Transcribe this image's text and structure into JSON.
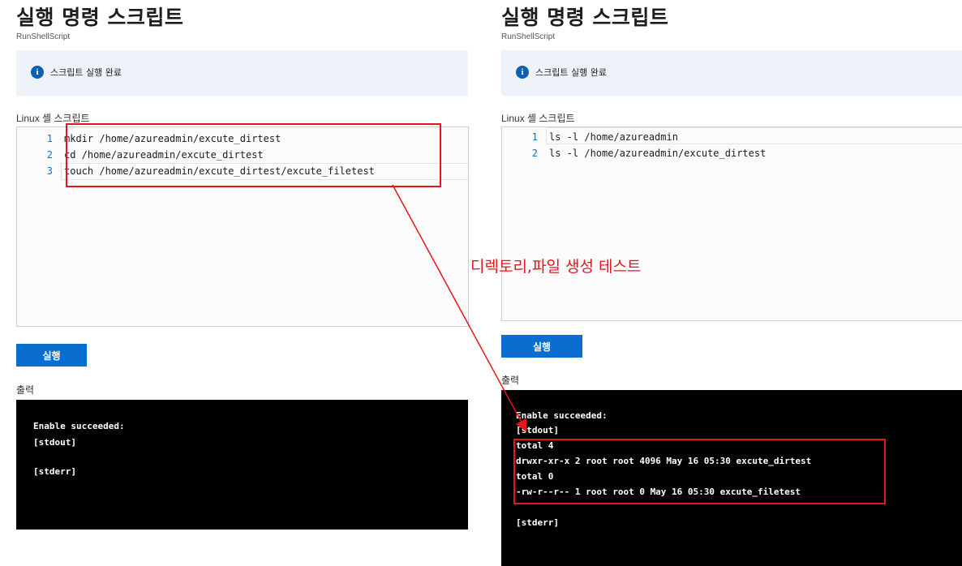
{
  "left": {
    "title": "실행 명령 스크립트",
    "subtitle": "RunShellScript",
    "banner_text": "스크립트 실행 완료",
    "editor_label": "Linux 셸 스크립트",
    "code_lines": [
      {
        "num": "1",
        "text": "mkdir /home/azureadmin/excute_dirtest"
      },
      {
        "num": "2",
        "text": "cd /home/azureadmin/excute_dirtest"
      },
      {
        "num": "3",
        "text": "touch /home/azureadmin/excute_dirtest/excute_filetest"
      }
    ],
    "run_label": "실행",
    "output_label": "출력",
    "output_lines": [
      "Enable succeeded:",
      "[stdout]",
      "",
      "[stderr]"
    ]
  },
  "right": {
    "title": "실행 명령 스크립트",
    "subtitle": "RunShellScript",
    "banner_text": "스크립트 실행 완료",
    "editor_label": "Linux 셸 스크립트",
    "code_lines": [
      {
        "num": "1",
        "text": "ls -l /home/azureadmin"
      },
      {
        "num": "2",
        "text": "ls -l /home/azureadmin/excute_dirtest"
      }
    ],
    "run_label": "실행",
    "output_label": "출력",
    "output_lines": [
      "Enable succeeded:",
      "[stdout]",
      "total 4",
      "drwxr-xr-x 2 root root 4096 May 16 05:30 excute_dirtest",
      "total 0",
      "-rw-r--r-- 1 root root 0 May 16 05:30 excute_filetest",
      "",
      "[stderr]"
    ]
  },
  "annotation": {
    "text": "디렉토리,파일 생성 테스트",
    "color": "#e8141c"
  },
  "colors": {
    "accent": "#0a6ed1",
    "info_icon": "#0c5fb3",
    "banner_bg": "#eef2f9",
    "terminal_bg": "#000000"
  },
  "icons": {
    "info": "info-icon",
    "info_glyph": "i"
  }
}
